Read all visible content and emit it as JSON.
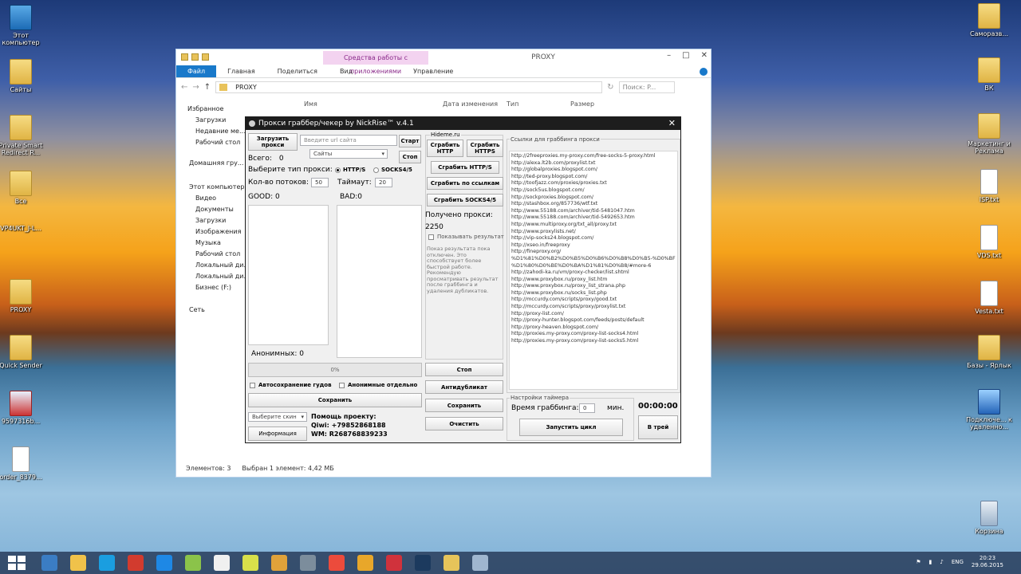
{
  "desktop_left": [
    {
      "label": "Этот компьютер",
      "type": "pc"
    },
    {
      "label": "Сайты",
      "type": "folder"
    },
    {
      "label": "Private Smart Redirect R...",
      "type": "folder"
    },
    {
      "label": "Все",
      "type": "folder"
    },
    {
      "label": "VP4UKT_J-L...",
      "type": "app"
    },
    {
      "label": "PROXY",
      "type": "folder"
    },
    {
      "label": "Quick Sender",
      "type": "folder"
    },
    {
      "label": "9597316b...",
      "type": "red"
    },
    {
      "label": "order_8379...",
      "type": "file"
    }
  ],
  "desktop_right": [
    {
      "label": "Саморазв...",
      "type": "folder"
    },
    {
      "label": "ВК",
      "type": "folder"
    },
    {
      "label": "Маркетинг и Реклама",
      "type": "folder"
    },
    {
      "label": "ISP.txt",
      "type": "file"
    },
    {
      "label": "VDS.txt",
      "type": "file"
    },
    {
      "label": "Vesta.txt",
      "type": "file"
    },
    {
      "label": "Базы - Ярлык",
      "type": "folder"
    },
    {
      "label": "Подключе... к удаленно...",
      "type": "conn"
    },
    {
      "label": "Корзина",
      "type": "bin"
    }
  ],
  "explorer": {
    "title": "PROXY",
    "context_tab": "Средства работы с приложениями",
    "tabs": [
      "Файл",
      "Главная",
      "Поделиться",
      "Вид"
    ],
    "manage_tab": "Управление",
    "address": "PROXY",
    "search_placeholder": "Поиск: P...",
    "columns": [
      "Имя",
      "Дата изменения",
      "Тип",
      "Размер"
    ],
    "nav_items": [
      "Избранное",
      "Загрузки",
      "Недавние ме...",
      "Рабочий стол",
      "Домашняя гру...",
      "Этот компьютер",
      "Видео",
      "Документы",
      "Загрузки",
      "Изображения",
      "Музыка",
      "Рабочий стол",
      "Локальный ди...",
      "Локальный ди...",
      "Бизнес (F:)",
      "Сеть"
    ],
    "status_count": "Элементов: 3",
    "status_selected": "Выбран 1 элемент: 4,42 МБ"
  },
  "app": {
    "title": "Прокси граббер/чекер by NickRise™ v.4.1",
    "load_sites_btn": "Загрузить прокси",
    "url_placeholder": "Введите url сайта",
    "start_btn": "Старт",
    "sites_select": "Сайты",
    "stop_top_btn": "Стоп",
    "total_label": "Всего:",
    "total_value": "0",
    "proxy_type_label": "Выберите тип прокси:",
    "type_http": "HTTP/S",
    "type_socks": "SOCKS4/5",
    "threads_label": "Кол-во потоков:",
    "threads_value": "50",
    "timeout_label": "Таймаут:",
    "timeout_value": "20",
    "good_label": "GOOD: 0",
    "bad_label": "BAD:0",
    "anon_label": "Анонимных: 0",
    "progress_text": "0%",
    "progress_value": 0,
    "autosave_label": "Автосохранение гудов",
    "anon_separate_label": "Анонимные отдельно",
    "save_btn": "Сохранить",
    "skin_select": "Выберите скин",
    "info_btn": "Информация",
    "help_title": "Помощь проекту:",
    "qiwi": "Qiwi: +79852868188",
    "wm": "WM: R268768839233",
    "hideme_label": "Hideme.ru",
    "grab_http_btn": "Сграбить HTTP",
    "grab_https_btn": "Сграбить HTTPS",
    "grab_https2_btn": "Сграбить HTTP/S",
    "grab_links_btn": "Сграбить по ссылкам",
    "grab_socks_btn": "Сграбить SOCKS4/5",
    "received_label": "Получено прокси:",
    "received_value": "2250",
    "show_result_label": "Показывать результат",
    "info_text": "Показ результата пока отключен. Это способствует более быстрой работе. Рекомендую просматривать результат после граббинга и удаления дубликатов.",
    "stop_btn": "Стоп",
    "antidup_btn": "Антидубликат",
    "save2_btn": "Сохранить",
    "clear_btn": "Очистить",
    "urls_label": "Ссылки для граббинга прокси",
    "urls": [
      "http://2freeproxies.my-proxy.com/free-socks-5-proxy.html",
      "http://alexa.lt2b.com/proxylist.txt",
      "http://globalproxies.blogspot.com/",
      "http://ted-proxy.blogspot.com/",
      "http://toofjazz.com/proxies/proxies.txt",
      "http://sock5us.blogspot.com/",
      "http://sockproxies.blogspot.com/",
      "http://stashbox.org/857736/wtf.txt",
      "http://www.55188.com/archiver/tid-5481047.htm",
      "http://www.55188.com/archiver/tid-5492653.htm",
      "http://www.multiproxy.org/txt_all/proxy.txt",
      "http://www.proxylists.net/",
      "http://vip-socks24.blogspot.com/",
      "http://xseo.in/freeproxy",
      "http://fineproxy.org/",
      "%D1%81%D0%B2%D0%B5%D0%B6%D0%B8%D0%B5-%D0%BF",
      "%D1%80%D0%BE%D0%BA%D1%81%D0%B8/#more-6",
      "http://zahodi-ka.ru/vm/proxy-checker/list.shtml",
      "http://www.proxybox.ru/proxy_list.htm",
      "http://www.proxybox.ru/proxy_list_strana.php",
      "http://www.proxybox.ru/socks_list.php",
      "http://mccurdy.com/scripts/proxy/good.txt",
      "http://mccurdy.com/scripts/proxy/proxylist.txt",
      "http://proxy-list.com/",
      "http://proxy-hunter.blogspot.com/feeds/posts/default",
      "http://proxy-heaven.blogspot.com/",
      "http://proxies.my-proxy.com/proxy-list-socks4.html",
      "http://proxies.my-proxy.com/proxy-list-socks5.html"
    ],
    "timer_group_label": "Настройки таймера",
    "grab_time_label": "Время граббинга:",
    "grab_time_value": "0",
    "min_label": "мин.",
    "timer_value": "00:00:00",
    "start_cycle_btn": "Запустить цикл",
    "tray_btn": "В трей"
  },
  "taskbar": {
    "lang": "ENG",
    "time": "20:23",
    "date": "29.06.2015",
    "apps": [
      "#3b7dc4",
      "#f0c24a",
      "#1a9ee0",
      "#d23b2e",
      "#1e88e5",
      "#8bc34a",
      "#f0f0f0",
      "#d8e04a",
      "#e0a23a",
      "#7c8d9c",
      "#ec4b3c",
      "#e8a72a",
      "#d0323c",
      "#1c3a5e",
      "#e6c45a",
      "#9fb6cf"
    ]
  },
  "colors": {
    "app_titlebar": "#1d1d1d",
    "ribbon_file": "#1979ca",
    "context_tab": "#f3d3f0"
  }
}
